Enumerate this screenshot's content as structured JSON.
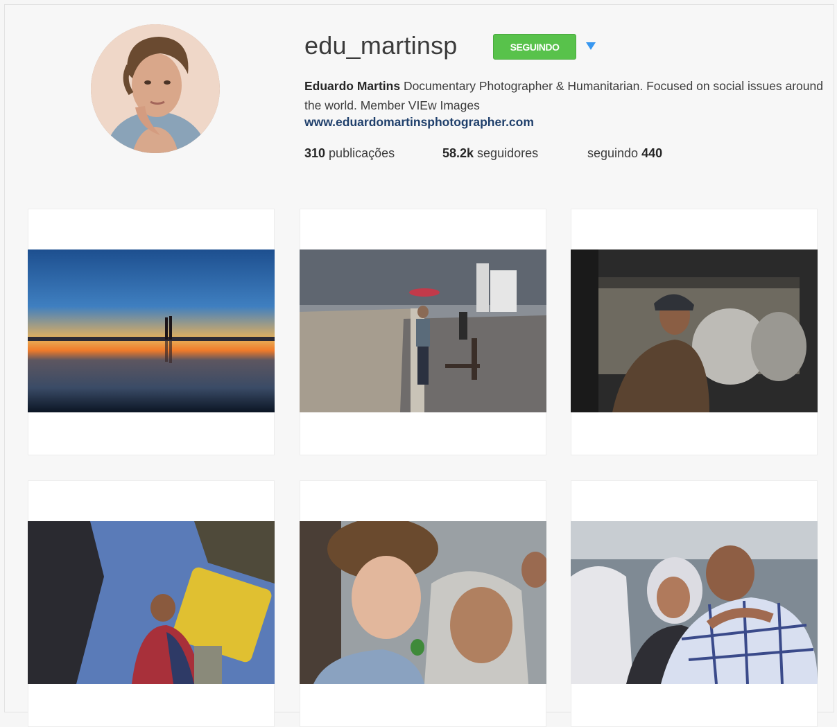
{
  "profile": {
    "username": "edu_martinsp",
    "follow_button_label": "SEGUINDO",
    "dropdown_icon": "triangle-down-icon",
    "full_name": "Eduardo Martins",
    "bio_text": " Documentary Photographer & Humanitarian. Focused on social issues around the world. Member VIEw Images",
    "website": "www.eduardomartinsphotographer.com",
    "stats": {
      "posts_count": "310",
      "posts_label": " publicações",
      "followers_count": "58.2k",
      "followers_label": " seguidores",
      "following_label": "seguindo ",
      "following_count": "440"
    }
  },
  "colors": {
    "follow_button": "#58c24b",
    "dropdown_arrow": "#3897f0",
    "website_link": "#1f3f6b"
  },
  "posts": [
    {
      "id": "post-sunset-couple"
    },
    {
      "id": "post-boy-on-seafront"
    },
    {
      "id": "post-boy-at-window"
    },
    {
      "id": "post-children-water-canister"
    },
    {
      "id": "post-child-and-woman"
    },
    {
      "id": "post-embrace"
    }
  ]
}
